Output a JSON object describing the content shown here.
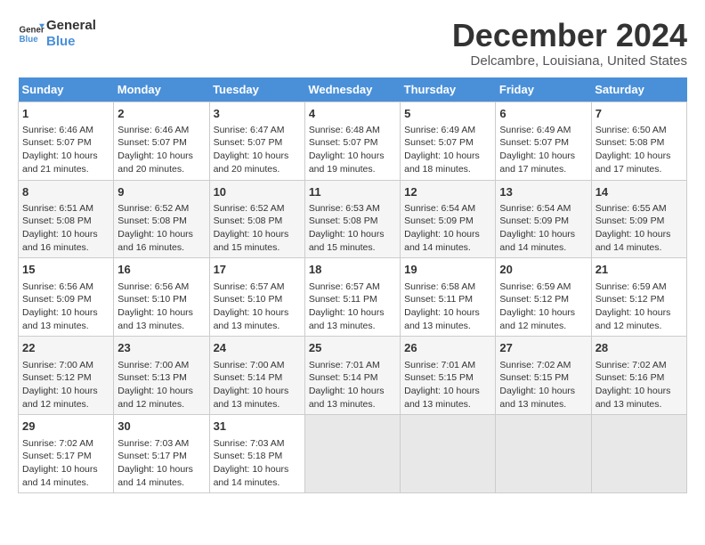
{
  "logo": {
    "line1": "General",
    "line2": "Blue"
  },
  "title": "December 2024",
  "location": "Delcambre, Louisiana, United States",
  "headers": [
    "Sunday",
    "Monday",
    "Tuesday",
    "Wednesday",
    "Thursday",
    "Friday",
    "Saturday"
  ],
  "weeks": [
    [
      {
        "day": "1",
        "info": "Sunrise: 6:46 AM\nSunset: 5:07 PM\nDaylight: 10 hours\nand 21 minutes."
      },
      {
        "day": "2",
        "info": "Sunrise: 6:46 AM\nSunset: 5:07 PM\nDaylight: 10 hours\nand 20 minutes."
      },
      {
        "day": "3",
        "info": "Sunrise: 6:47 AM\nSunset: 5:07 PM\nDaylight: 10 hours\nand 20 minutes."
      },
      {
        "day": "4",
        "info": "Sunrise: 6:48 AM\nSunset: 5:07 PM\nDaylight: 10 hours\nand 19 minutes."
      },
      {
        "day": "5",
        "info": "Sunrise: 6:49 AM\nSunset: 5:07 PM\nDaylight: 10 hours\nand 18 minutes."
      },
      {
        "day": "6",
        "info": "Sunrise: 6:49 AM\nSunset: 5:07 PM\nDaylight: 10 hours\nand 17 minutes."
      },
      {
        "day": "7",
        "info": "Sunrise: 6:50 AM\nSunset: 5:08 PM\nDaylight: 10 hours\nand 17 minutes."
      }
    ],
    [
      {
        "day": "8",
        "info": "Sunrise: 6:51 AM\nSunset: 5:08 PM\nDaylight: 10 hours\nand 16 minutes."
      },
      {
        "day": "9",
        "info": "Sunrise: 6:52 AM\nSunset: 5:08 PM\nDaylight: 10 hours\nand 16 minutes."
      },
      {
        "day": "10",
        "info": "Sunrise: 6:52 AM\nSunset: 5:08 PM\nDaylight: 10 hours\nand 15 minutes."
      },
      {
        "day": "11",
        "info": "Sunrise: 6:53 AM\nSunset: 5:08 PM\nDaylight: 10 hours\nand 15 minutes."
      },
      {
        "day": "12",
        "info": "Sunrise: 6:54 AM\nSunset: 5:09 PM\nDaylight: 10 hours\nand 14 minutes."
      },
      {
        "day": "13",
        "info": "Sunrise: 6:54 AM\nSunset: 5:09 PM\nDaylight: 10 hours\nand 14 minutes."
      },
      {
        "day": "14",
        "info": "Sunrise: 6:55 AM\nSunset: 5:09 PM\nDaylight: 10 hours\nand 14 minutes."
      }
    ],
    [
      {
        "day": "15",
        "info": "Sunrise: 6:56 AM\nSunset: 5:09 PM\nDaylight: 10 hours\nand 13 minutes."
      },
      {
        "day": "16",
        "info": "Sunrise: 6:56 AM\nSunset: 5:10 PM\nDaylight: 10 hours\nand 13 minutes."
      },
      {
        "day": "17",
        "info": "Sunrise: 6:57 AM\nSunset: 5:10 PM\nDaylight: 10 hours\nand 13 minutes."
      },
      {
        "day": "18",
        "info": "Sunrise: 6:57 AM\nSunset: 5:11 PM\nDaylight: 10 hours\nand 13 minutes."
      },
      {
        "day": "19",
        "info": "Sunrise: 6:58 AM\nSunset: 5:11 PM\nDaylight: 10 hours\nand 13 minutes."
      },
      {
        "day": "20",
        "info": "Sunrise: 6:59 AM\nSunset: 5:12 PM\nDaylight: 10 hours\nand 12 minutes."
      },
      {
        "day": "21",
        "info": "Sunrise: 6:59 AM\nSunset: 5:12 PM\nDaylight: 10 hours\nand 12 minutes."
      }
    ],
    [
      {
        "day": "22",
        "info": "Sunrise: 7:00 AM\nSunset: 5:12 PM\nDaylight: 10 hours\nand 12 minutes."
      },
      {
        "day": "23",
        "info": "Sunrise: 7:00 AM\nSunset: 5:13 PM\nDaylight: 10 hours\nand 12 minutes."
      },
      {
        "day": "24",
        "info": "Sunrise: 7:00 AM\nSunset: 5:14 PM\nDaylight: 10 hours\nand 13 minutes."
      },
      {
        "day": "25",
        "info": "Sunrise: 7:01 AM\nSunset: 5:14 PM\nDaylight: 10 hours\nand 13 minutes."
      },
      {
        "day": "26",
        "info": "Sunrise: 7:01 AM\nSunset: 5:15 PM\nDaylight: 10 hours\nand 13 minutes."
      },
      {
        "day": "27",
        "info": "Sunrise: 7:02 AM\nSunset: 5:15 PM\nDaylight: 10 hours\nand 13 minutes."
      },
      {
        "day": "28",
        "info": "Sunrise: 7:02 AM\nSunset: 5:16 PM\nDaylight: 10 hours\nand 13 minutes."
      }
    ],
    [
      {
        "day": "29",
        "info": "Sunrise: 7:02 AM\nSunset: 5:17 PM\nDaylight: 10 hours\nand 14 minutes."
      },
      {
        "day": "30",
        "info": "Sunrise: 7:03 AM\nSunset: 5:17 PM\nDaylight: 10 hours\nand 14 minutes."
      },
      {
        "day": "31",
        "info": "Sunrise: 7:03 AM\nSunset: 5:18 PM\nDaylight: 10 hours\nand 14 minutes."
      },
      {
        "day": "",
        "info": ""
      },
      {
        "day": "",
        "info": ""
      },
      {
        "day": "",
        "info": ""
      },
      {
        "day": "",
        "info": ""
      }
    ]
  ]
}
